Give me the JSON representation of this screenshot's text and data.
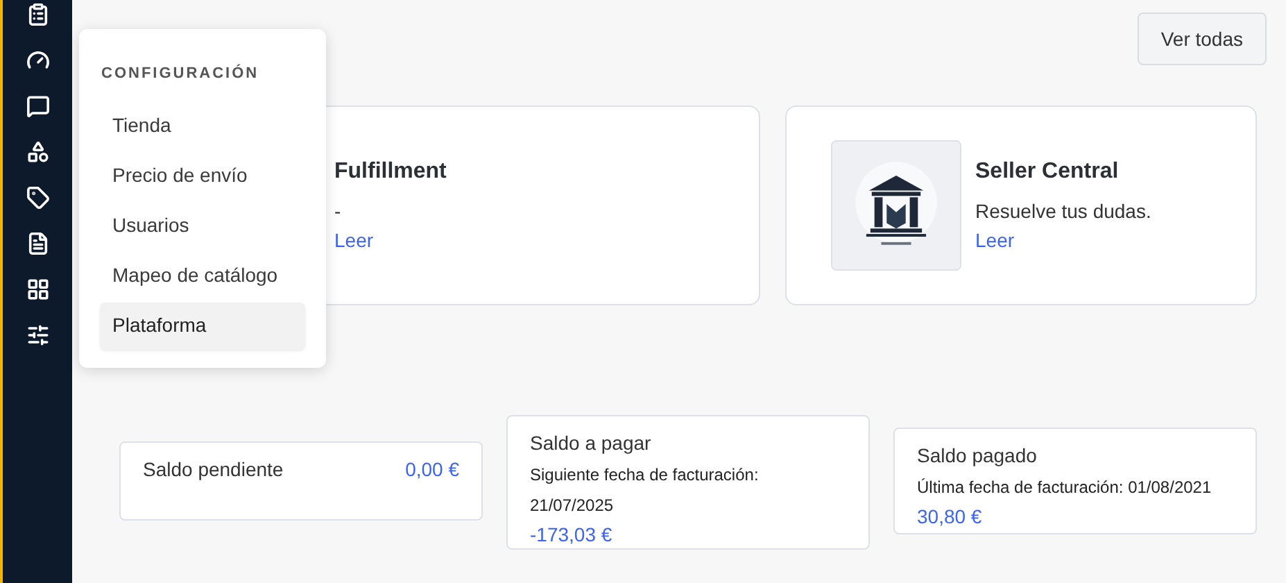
{
  "header": {
    "button": "Ver todas"
  },
  "guides": [
    {
      "title": "Fulfillment",
      "text": "-",
      "link": "Leer"
    },
    {
      "title": "Seller Central",
      "text": "Resuelve tus dudas.",
      "link": "Leer"
    }
  ],
  "balances": [
    {
      "title": "Saldo pendiente",
      "amount": "0,00 €",
      "kind": "inline"
    },
    {
      "title": "Saldo a pagar",
      "note": "Siguiente fecha de facturación: 21/07/2025",
      "amount": "-173,03 €",
      "kind": "stacked"
    },
    {
      "title": "Saldo pagado",
      "note": "Última fecha de facturación: 01/08/2021",
      "amount": "30,80 €",
      "kind": "stacked"
    }
  ],
  "menu": {
    "heading": "CONFIGURACIÓN",
    "items": [
      {
        "label": "Tienda",
        "selected": false
      },
      {
        "label": "Precio de envío",
        "selected": false
      },
      {
        "label": "Usuarios",
        "selected": false
      },
      {
        "label": "Mapeo de catálogo",
        "selected": false
      },
      {
        "label": "Plataforma",
        "selected": true
      }
    ]
  }
}
